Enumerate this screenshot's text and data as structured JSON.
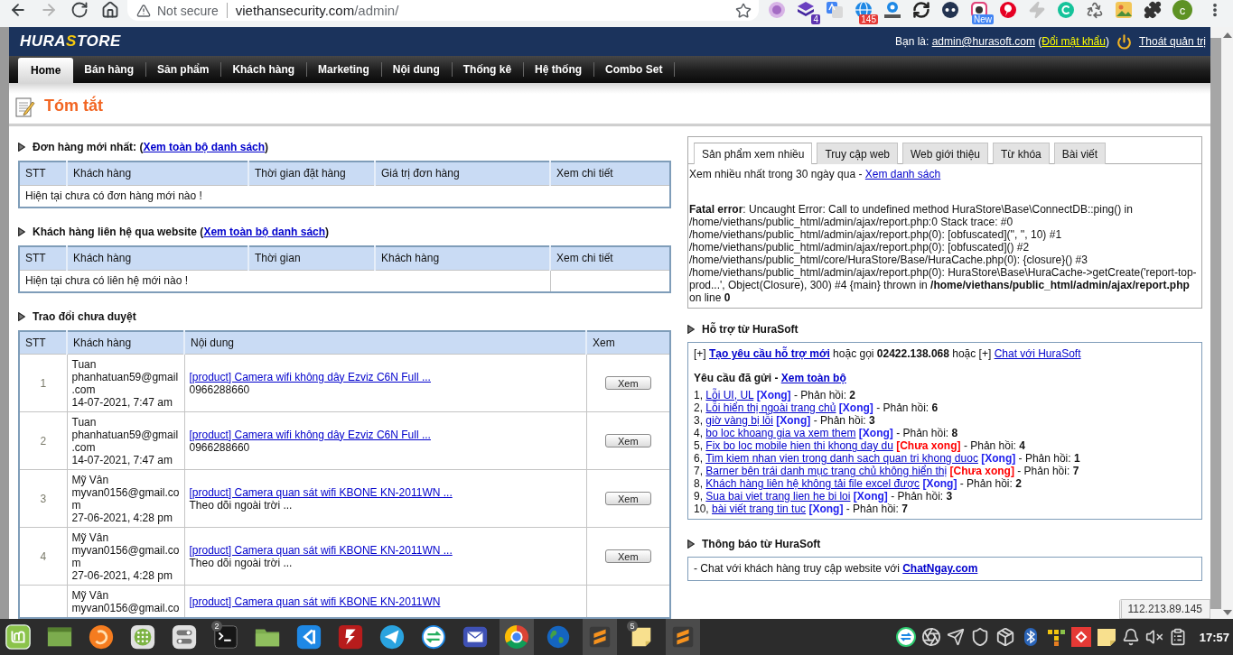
{
  "browser": {
    "nav_buttons": [
      {
        "kind": "back",
        "disabled": false
      },
      {
        "kind": "forward",
        "disabled": true
      },
      {
        "kind": "reload",
        "disabled": false
      },
      {
        "kind": "home",
        "disabled": false
      }
    ],
    "security": "Not secure",
    "url_host": "viethansecurity.com",
    "url_path": "/admin/",
    "extensions": [
      {
        "kind": "orb"
      },
      {
        "kind": "stack",
        "badge": "4"
      },
      {
        "kind": "translate"
      },
      {
        "kind": "globe",
        "badge": "145"
      },
      {
        "kind": "scale"
      },
      {
        "kind": "sync"
      },
      {
        "kind": "ip"
      },
      {
        "kind": "camera",
        "badge": "New"
      },
      {
        "kind": "pin"
      },
      {
        "kind": "bolt"
      },
      {
        "kind": "check"
      },
      {
        "kind": "recycle"
      },
      {
        "kind": "picture"
      },
      {
        "kind": "puzzle"
      }
    ],
    "profile": "c"
  },
  "header": {
    "logo": [
      {
        "text": "HURA",
        "accent": false
      },
      {
        "text": "S",
        "accent": true
      },
      {
        "text": "TORE",
        "accent": false
      }
    ],
    "account": [
      {
        "kind": "text",
        "text": "Bạn là: "
      },
      {
        "kind": "link",
        "text": "admin@hurasoft.com"
      },
      {
        "kind": "text",
        "text": " ("
      },
      {
        "kind": "accent_link",
        "text": "Đổi mật khẩu"
      },
      {
        "kind": "text",
        "text": ")"
      }
    ],
    "logout": "Thoát quản trị"
  },
  "nav": [
    {
      "label": "Home",
      "selected": true
    },
    {
      "label": "Bán hàng",
      "selected": false
    },
    {
      "label": "Sản phẩm",
      "selected": false
    },
    {
      "label": "Khách hàng",
      "selected": false
    },
    {
      "label": "Marketing",
      "selected": false
    },
    {
      "label": "Nội dung",
      "selected": false
    },
    {
      "label": "Thống kê",
      "selected": false
    },
    {
      "label": "Hệ thống",
      "selected": false
    },
    {
      "label": "Combo Set",
      "selected": false
    }
  ],
  "page_title": "Tóm tắt",
  "orders": {
    "heading": [
      {
        "kind": "text",
        "text": "Đơn hàng mới nhất: ("
      },
      {
        "kind": "link",
        "text": "Xem toàn bộ danh sách"
      },
      {
        "kind": "text",
        "text": ")"
      }
    ],
    "columns": [
      "STT",
      "Khách hàng",
      "Thời gian đặt hàng",
      "Giá trị đơn hàng",
      "Xem chi tiết"
    ],
    "empty": "Hiện tại chưa có đơn hàng mới nào !",
    "empty_spans_all": true
  },
  "contacts": {
    "heading": [
      {
        "kind": "text",
        "text": "Khách hàng liên hệ qua website ("
      },
      {
        "kind": "link",
        "text": "Xem toàn bộ danh sách"
      },
      {
        "kind": "text",
        "text": ")"
      }
    ],
    "columns": [
      "STT",
      "Khách hàng",
      "Thời gian",
      "Khách hàng",
      "Xem chi tiết"
    ],
    "empty": "Hiện tại chưa có liên hệ mới nào !",
    "empty_spans_all": false
  },
  "discussions": {
    "heading": [
      {
        "kind": "text",
        "text": "Trao đổi chưa duyệt"
      }
    ],
    "columns": [
      "STT",
      "Khách hàng",
      "Nội dung",
      "Xem"
    ],
    "rows": [
      {
        "stt": "1",
        "name": "Tuan",
        "email": "phanhatuan59@gmail.com",
        "date": "14-07-2021, 7:47 am",
        "link": "[product] Camera wifi không dây Ezviz C6N Full ...",
        "note": "0966288660",
        "button": "Xem"
      },
      {
        "stt": "2",
        "name": "Tuan",
        "email": "phanhatuan59@gmail.com",
        "date": "14-07-2021, 7:47 am",
        "link": "[product] Camera wifi không dây Ezviz C6N Full ...",
        "note": "0966288660",
        "button": "Xem"
      },
      {
        "stt": "3",
        "name": "Mỹ Vân",
        "email": "myvan0156@gmail.com",
        "date": "27-06-2021, 4:28 pm",
        "link": "[product] Camera quan sát wifi KBONE KN-2011WN ...",
        "note": "Theo dõi ngoài trời ...",
        "button": "Xem"
      },
      {
        "stt": "4",
        "name": "Mỹ Vân",
        "email": "myvan0156@gmail.com",
        "date": "27-06-2021, 4:28 pm",
        "link": "[product] Camera quan sát wifi KBONE KN-2011WN ...",
        "note": "Theo dõi ngoài trời ...",
        "button": "Xem"
      },
      {
        "name": "Mỹ Vân",
        "email": "myvan0156@gmail.co",
        "link": "[product] Camera quan sát wifi KBONE KN-2011WN"
      }
    ]
  },
  "top_products": {
    "tabs": [
      {
        "label": "Sản phẩm xem nhiều",
        "selected": true
      },
      {
        "label": "Truy cập web",
        "selected": false
      },
      {
        "label": "Web giới thiệu",
        "selected": false
      },
      {
        "label": "Từ khóa",
        "selected": false
      },
      {
        "label": "Bài viết",
        "selected": false
      }
    ],
    "summary": [
      {
        "kind": "text",
        "text": "Xem nhiều nhất trong 30 ngày qua - "
      },
      {
        "kind": "link",
        "text": "Xem danh sách"
      }
    ],
    "error": "**Fatal error**: Uncaught Error: Call to undefined method HuraStore\\Base\\ConnectDB::ping() in /home/viethans/public_html/admin/ajax/report.php:0 Stack trace: #0 /home/viethans/public_html/admin/ajax/report.php(0): [obfuscated]('', '', 10) #1 /home/viethans/public_html/admin/ajax/report.php(0): [obfuscated]() #2 /home/viethans/public_html/core/HuraStore/Base/HuraCache.php(0): {closure}() #3 /home/viethans/public_html/admin/ajax/report.php(0): HuraStore\\Base\\HuraCache->getCreate('report-top-prod...', Object(Closure), 300) #4 {main} thrown in **/home/viethans/public_html/admin/ajax/report.php** on line **0**"
  },
  "support": {
    "heading": [
      {
        "kind": "text",
        "text": "Hỗ trợ từ HuraSoft"
      }
    ],
    "intro": [
      {
        "kind": "text",
        "text": "[+] "
      },
      {
        "kind": "strong_link",
        "text": "Tạo yêu cầu hỗ trợ mới"
      },
      {
        "kind": "text",
        "text": " hoặc gọi "
      },
      {
        "kind": "bold",
        "text": "02422.138.068"
      },
      {
        "kind": "text",
        "text": " hoặc [+] "
      },
      {
        "kind": "link",
        "text": "Chat với HuraSoft"
      }
    ],
    "sent": [
      {
        "kind": "bold",
        "text": "Yêu cầu đã gửi - "
      },
      {
        "kind": "strong_link",
        "text": "Xem toàn bộ"
      }
    ],
    "requests": [
      {
        "number": "1,",
        "title": "Lỗi UI, UL",
        "status": "[Xong]",
        "done": true,
        "reply_label": "- Phản hồi:",
        "replies": "2"
      },
      {
        "number": "2,",
        "title": "Lỗi hiển thị ngoài trang chủ",
        "status": "[Xong]",
        "done": true,
        "reply_label": "- Phản hồi:",
        "replies": "6"
      },
      {
        "number": "3,",
        "title": "giờ vàng bị lỗi",
        "status": "[Xong]",
        "done": true,
        "reply_label": "- Phản hồi:",
        "replies": "3"
      },
      {
        "number": "4,",
        "title": "bo loc khoang gia va xem them",
        "status": "[Xong]",
        "done": true,
        "reply_label": "- Phản hồi:",
        "replies": "8"
      },
      {
        "number": "5,",
        "title": "Fix bo loc mobile hien thi khong day du",
        "status": "[Chưa xong]",
        "done": false,
        "reply_label": "- Phản hồi:",
        "replies": "4"
      },
      {
        "number": "6,",
        "title": "Tim kiem nhan vien trong danh sach quan tri khong duoc",
        "status": "[Xong]",
        "done": true,
        "reply_label": "- Phản hồi:",
        "replies": "1"
      },
      {
        "number": "7,",
        "title": "Barner bên trái danh mục trang chủ không hiển thị",
        "status": "[Chưa xong]",
        "done": false,
        "reply_label": "- Phản hồi:",
        "replies": "7"
      },
      {
        "number": "8,",
        "title": "Khách hàng liên hệ không tải file excel được",
        "status": "[Xong]",
        "done": true,
        "reply_label": "- Phản hồi:",
        "replies": "2"
      },
      {
        "number": "9,",
        "title": "Sua bai viet trang lien he bi loi",
        "status": "[Xong]",
        "done": true,
        "reply_label": "- Phản hồi:",
        "replies": "3"
      },
      {
        "number": "10,",
        "title": "bài viết trang tin tuc",
        "status": "[Xong]",
        "done": true,
        "reply_label": "- Phản hồi:",
        "replies": "7"
      }
    ]
  },
  "notices": {
    "heading": [
      {
        "kind": "text",
        "text": "Thông báo từ HuraSoft"
      }
    ],
    "message": [
      {
        "kind": "text",
        "text": "- Chat với khách hàng truy cập website với "
      },
      {
        "kind": "strong_link",
        "text": "ChatNgay.com"
      }
    ]
  },
  "status_tooltip": "112.213.89.145",
  "taskbar": {
    "apps": [
      {
        "kind": "logo",
        "active": false
      },
      {
        "kind": "window",
        "active": false
      },
      {
        "kind": "fox",
        "active": false
      },
      {
        "kind": "grid",
        "active": false
      },
      {
        "kind": "toggle",
        "active": false
      },
      {
        "kind": "terminal",
        "active": false,
        "badge": "2"
      },
      {
        "kind": "folder",
        "active": false
      },
      {
        "kind": "code",
        "active": false
      },
      {
        "kind": "ftp",
        "active": false
      },
      {
        "kind": "plane",
        "active": false
      },
      {
        "kind": "remote",
        "active": false
      },
      {
        "kind": "mail",
        "active": false
      },
      {
        "kind": "browser",
        "active": true
      },
      {
        "kind": "globe",
        "active": false
      },
      {
        "kind": "editor",
        "active": true
      },
      {
        "kind": "notes",
        "active": false,
        "badge": "5"
      },
      {
        "kind": "editor",
        "active": true
      }
    ],
    "tray": [
      {
        "kind": "sync"
      },
      {
        "kind": "aperture"
      },
      {
        "kind": "send"
      },
      {
        "kind": "shield"
      },
      {
        "kind": "package"
      },
      {
        "kind": "bluetooth"
      },
      {
        "kind": "blocks"
      },
      {
        "kind": "diamond"
      },
      {
        "kind": "note"
      },
      {
        "kind": "bell"
      },
      {
        "kind": "muted"
      },
      {
        "kind": "clipboard"
      }
    ],
    "clock": "17:57"
  }
}
